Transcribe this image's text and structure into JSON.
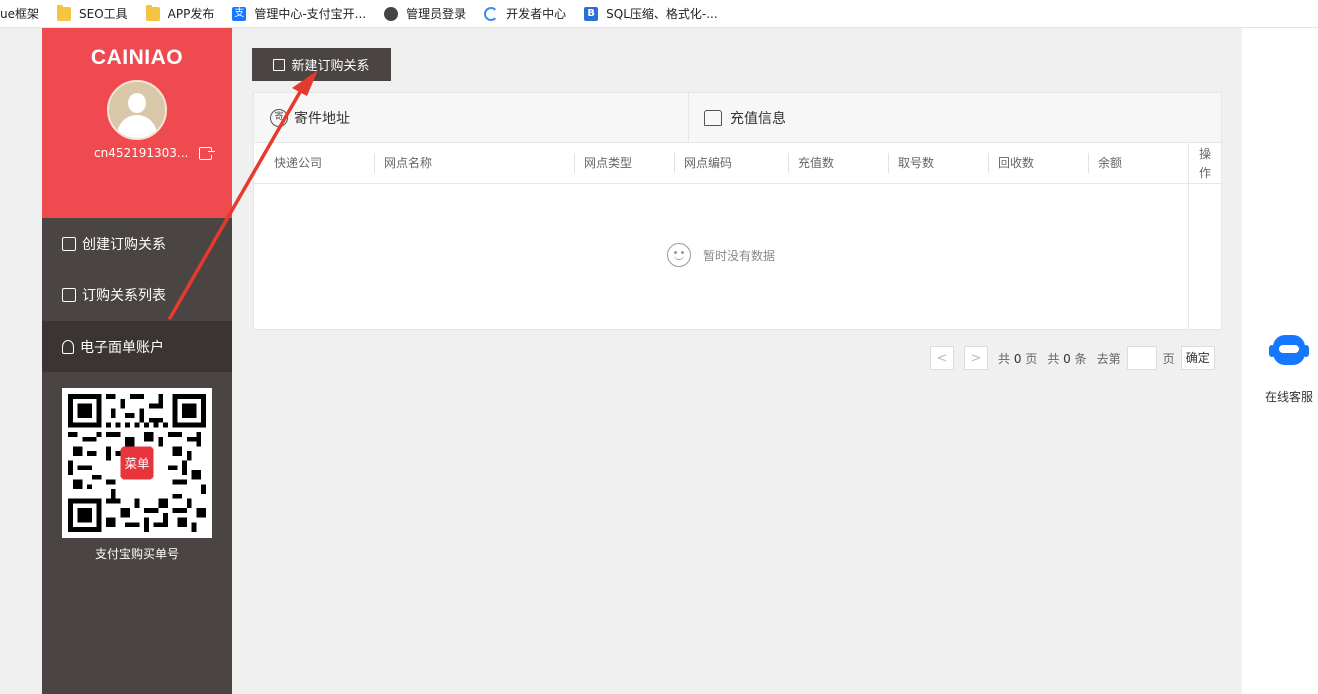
{
  "bookmarks": [
    {
      "label": "ue框架",
      "icon": "none"
    },
    {
      "label": "SEO工具",
      "icon": "folder-icon"
    },
    {
      "label": "APP发布",
      "icon": "folder-icon"
    },
    {
      "label": "管理中心-支付宝开...",
      "icon": "alipay-icon"
    },
    {
      "label": "管理员登录",
      "icon": "globe-icon"
    },
    {
      "label": "开发者中心",
      "icon": "dev-icon"
    },
    {
      "label": "SQL压缩、格式化-...",
      "icon": "sql-icon"
    }
  ],
  "sidebar": {
    "brand": "CAINIAO",
    "username": "cn452191303...",
    "menu": [
      {
        "label": "创建订购关系",
        "icon": "edit-icon"
      },
      {
        "label": "订购关系列表",
        "icon": "list-icon"
      },
      {
        "label": "电子面单账户",
        "icon": "user-icon",
        "active": true
      }
    ],
    "qr_badge": "菜单",
    "qr_caption": "支付宝购买单号"
  },
  "toolbar": {
    "new_label": "新建订购关系"
  },
  "tabs": [
    {
      "label": "寄件地址",
      "icon_text": "寄"
    },
    {
      "label": "充值信息"
    }
  ],
  "table": {
    "columns": [
      "快递公司",
      "网点名称",
      "网点类型",
      "网点编码",
      "充值数",
      "取号数",
      "回收数",
      "余额"
    ],
    "op_header": "操作",
    "empty_text": "暂时没有数据"
  },
  "pagination": {
    "prev": "<",
    "next": ">",
    "total_pages_prefix": "共",
    "total_pages": "0",
    "total_pages_suffix": "页",
    "total_items_prefix": "共",
    "total_items": "0",
    "total_items_suffix": "条",
    "goto_label": "去第",
    "goto_suffix": "页",
    "ok_label": "确定"
  },
  "customer_service": {
    "label": "在线客服"
  },
  "colors": {
    "brand_red": "#f04a51",
    "sidebar_dark": "#4a4443",
    "service_blue": "#1677ff"
  }
}
